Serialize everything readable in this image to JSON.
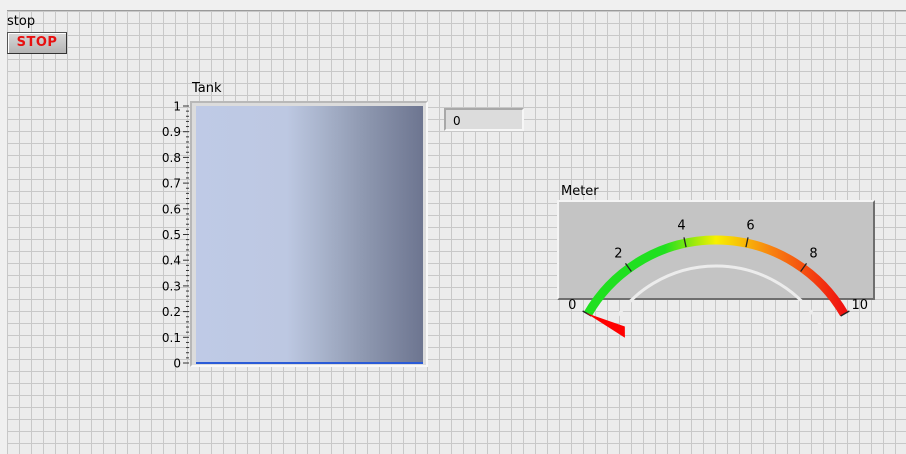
{
  "stop": {
    "label": "stop",
    "button_text": "STOP",
    "button_text_color": "#e81010"
  },
  "tank": {
    "label": "Tank",
    "scale_labels": [
      "1",
      "0.9",
      "0.8",
      "0.7",
      "0.6",
      "0.5",
      "0.4",
      "0.3",
      "0.2",
      "0.1",
      "0"
    ],
    "scale_min": 0,
    "scale_max": 1,
    "level": 0,
    "fill_color": "#2a5bd7"
  },
  "indicator": {
    "value": "0"
  },
  "meter": {
    "label": "Meter",
    "scale_labels": [
      "0",
      "2",
      "4",
      "6",
      "8",
      "10"
    ],
    "scale_min": 0,
    "scale_max": 10,
    "value": 0,
    "colors": {
      "low": "#20e020",
      "mid": "#f8f000",
      "high": "#f01010",
      "needle": "#ff0000"
    }
  }
}
